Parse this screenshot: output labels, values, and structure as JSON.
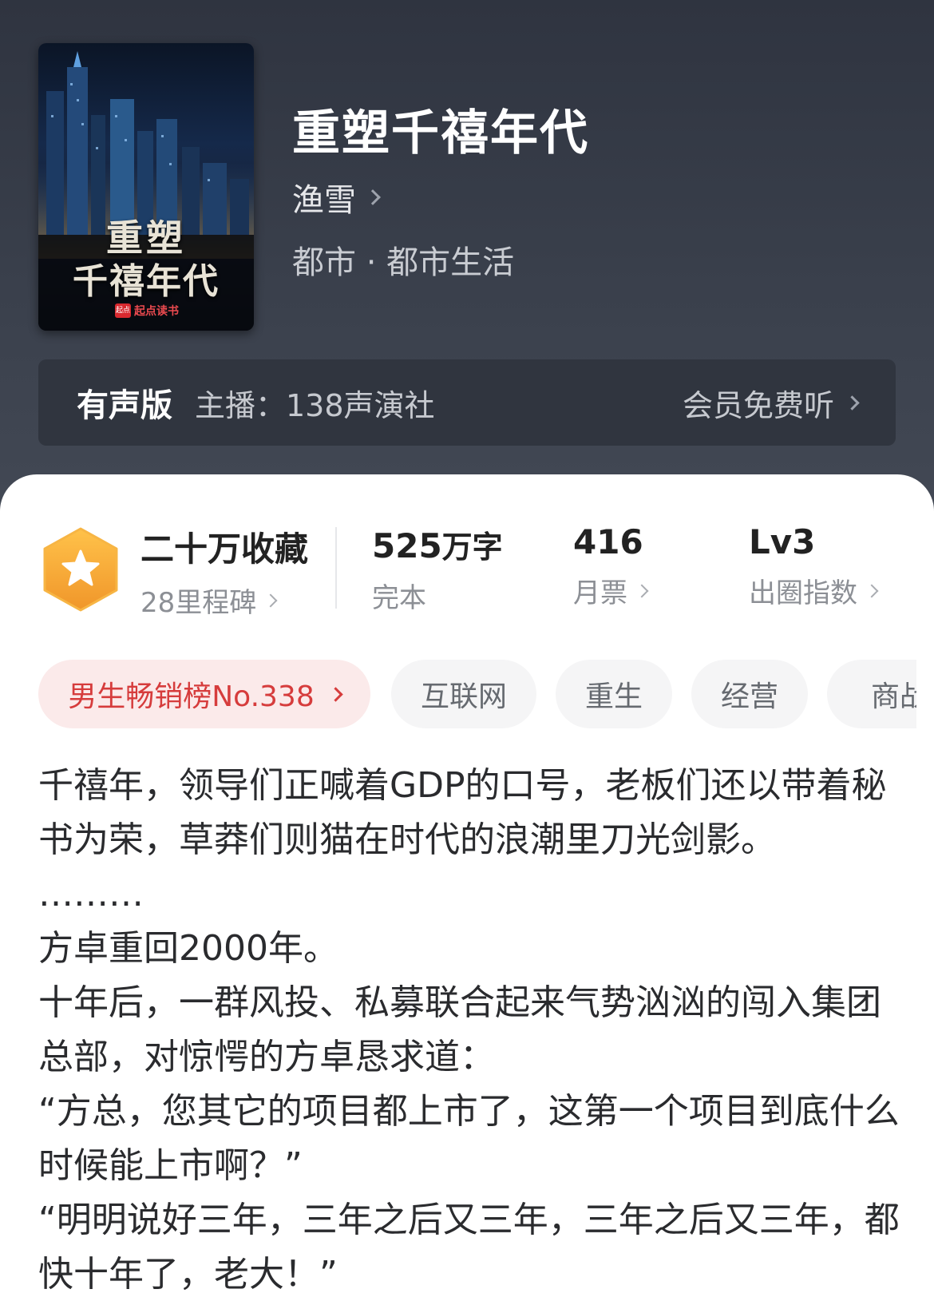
{
  "book": {
    "title": "重塑千禧年代",
    "author": "渔雪",
    "genre": "都市 · 都市生活",
    "cover": {
      "title_line1": "重塑",
      "title_line2": "千禧年代",
      "publisher_mark": "起点",
      "publisher": "起点读书"
    }
  },
  "audio": {
    "label": "有声版",
    "host": "主播：138声演社",
    "action": "会员免费听"
  },
  "stats": [
    {
      "value": "二十万收藏",
      "label": "28里程碑"
    },
    {
      "value": "525",
      "unit": "万字",
      "label": "完本"
    },
    {
      "value": "416",
      "label": "月票"
    },
    {
      "value": "Lv3",
      "label": "出圈指数"
    }
  ],
  "tags": {
    "rank": "男生畅销榜No.338",
    "items": [
      "互联网",
      "重生",
      "经营",
      "商战"
    ]
  },
  "description": [
    "千禧年，领导们正喊着GDP的口号，老板们还以带着秘书为荣，草莽们则猫在时代的浪潮里刀光剑影。",
    "………",
    "方卓重回2000年。",
    "十年后，一群风投、私募联合起来气势汹汹的闯入集团总部，对惊愕的方卓恳求道：",
    "“方总，您其它的项目都上市了，这第一个项目到底什么时候能上市啊？”",
    "“明明说好三年，三年之后又三年，三年之后又三年，都快十年了，老大！”"
  ],
  "colors": {
    "header_bg": "#3a404c",
    "rank_tag": "#d63c3c",
    "badge": "#f5a623"
  }
}
